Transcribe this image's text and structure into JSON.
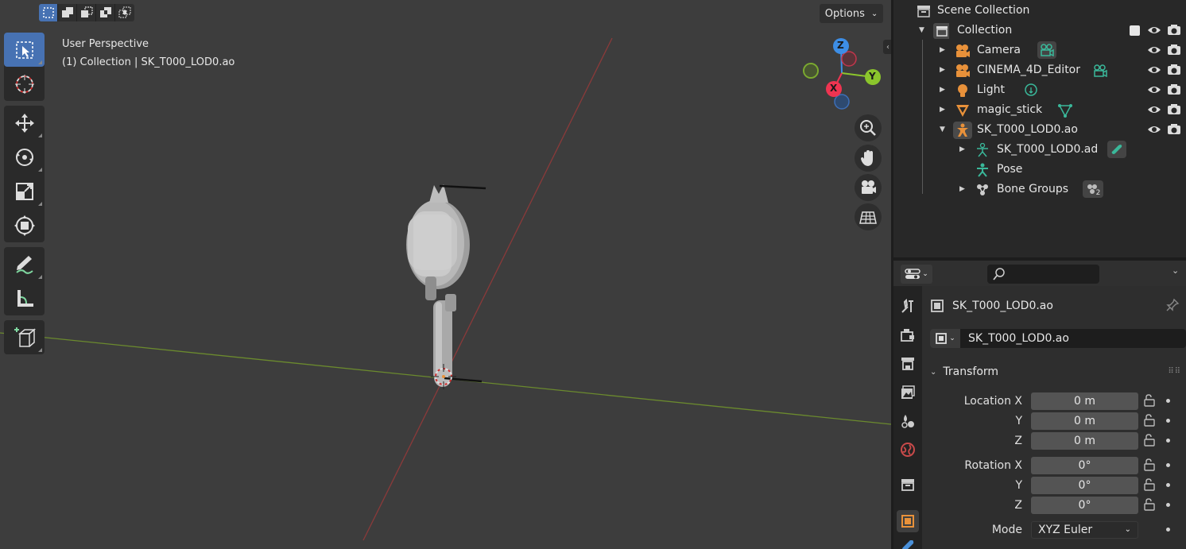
{
  "viewport": {
    "perspective": "User Perspective",
    "collection_info": "(1) Collection | SK_T000_LOD0.ao",
    "options_label": "Options",
    "gizmo": {
      "z": "Z",
      "y": "Y",
      "x": "X"
    }
  },
  "toolbar": {
    "tools": [
      "select-box",
      "cursor",
      "move",
      "rotate",
      "scale",
      "transform",
      "annotate",
      "measure",
      "add-cube"
    ]
  },
  "outliner": {
    "scene_collection": "Scene Collection",
    "collection": "Collection",
    "items": [
      {
        "label": "Camera",
        "icon": "camera-object-icon",
        "badge": "camera-data-icon"
      },
      {
        "label": "CINEMA_4D_Editor",
        "icon": "camera-object-icon",
        "badge": "camera-data-icon"
      },
      {
        "label": "Light",
        "icon": "light-object-icon",
        "badge": "light-data-icon"
      },
      {
        "label": "magic_stick",
        "icon": "mesh-object-icon",
        "badge": "mesh-data-icon"
      },
      {
        "label": "SK_T000_LOD0.ao",
        "icon": "armature-object-icon"
      }
    ],
    "children": [
      {
        "label": "SK_T000_LOD0.ad",
        "icon": "armature-data-icon",
        "badge": "modifier-icon"
      },
      {
        "label": "Pose",
        "icon": "pose-icon"
      },
      {
        "label": "Bone Groups",
        "icon": "bone-groups-icon",
        "badge_count": "2"
      }
    ]
  },
  "properties": {
    "object_name": "SK_T000_LOD0.ao",
    "object_field": "SK_T000_LOD0.ao",
    "section": "Transform",
    "location": {
      "label_x": "Location X",
      "label_y": "Y",
      "label_z": "Z",
      "x": "0 m",
      "y": "0 m",
      "z": "0 m"
    },
    "rotation": {
      "label_x": "Rotation X",
      "label_y": "Y",
      "label_z": "Z",
      "x": "0°",
      "y": "0°",
      "z": "0°"
    },
    "mode_label": "Mode",
    "mode_value": "XYZ Euler"
  },
  "colors": {
    "accent": "#4772b3",
    "x_axis": "#ee3451",
    "y_axis": "#8bc52c",
    "z_axis": "#3d8ee6",
    "x_line": "#8a3a3a",
    "y_line": "#6b8a2e",
    "object_orange": "#e8913a",
    "data_green": "#3ab89a"
  }
}
